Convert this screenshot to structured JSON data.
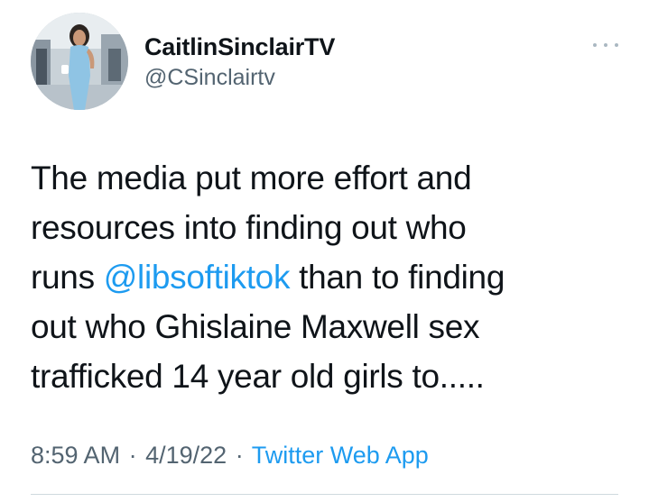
{
  "author": {
    "display_name": "CaitlinSinclairTV",
    "handle": "@CSinclairtv"
  },
  "menu": {
    "icon": "more-horizontal-icon"
  },
  "tweet": {
    "text_line1": "The media put more effort and",
    "text_line2": "resources into finding out who",
    "text_line3_before": "runs ",
    "mention": "@libsoftiktok",
    "text_line3_after": " than to finding",
    "text_line4": "out who Ghislaine Maxwell sex",
    "text_line5": "trafficked 14 year old girls to....."
  },
  "meta": {
    "time": "8:59 AM",
    "separator": "·",
    "date": "4/19/22",
    "source": "Twitter Web App"
  },
  "colors": {
    "link": "#1d9bf0",
    "secondary_text": "#536471",
    "text": "#0f1419"
  }
}
